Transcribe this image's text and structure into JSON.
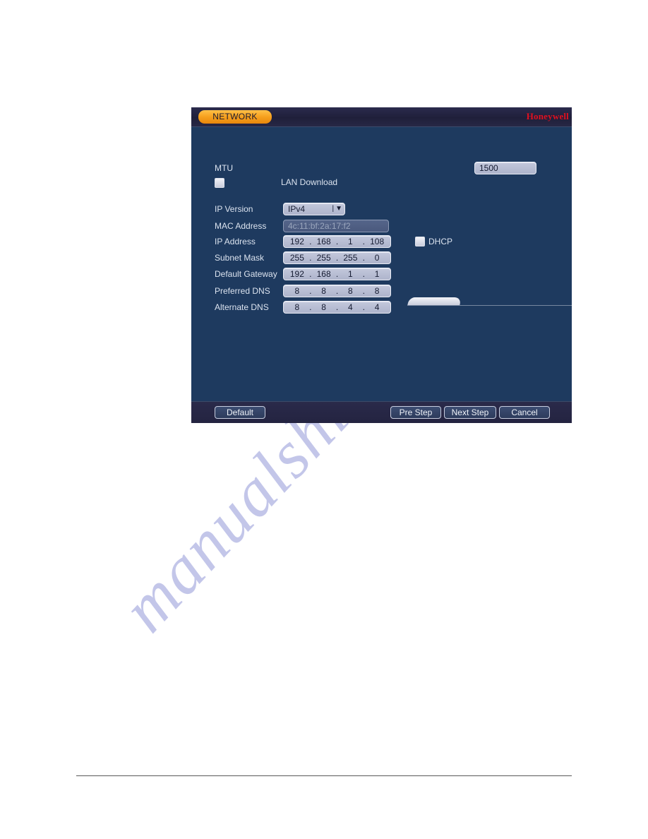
{
  "window": {
    "title": "NETWORK",
    "brand": "Honeywell"
  },
  "form": {
    "mtu": {
      "label": "MTU",
      "value": "1500"
    },
    "lan_download": {
      "label": "LAN Download",
      "checked": false
    },
    "ip_version": {
      "label": "IP Version",
      "value": "IPv4"
    },
    "mac_address": {
      "label": "MAC Address",
      "value": "4c:11:bf:2a:17:f2"
    },
    "ip_address": {
      "label": "IP Address",
      "octets": [
        "192",
        "168",
        "1",
        "108"
      ]
    },
    "subnet_mask": {
      "label": "Subnet Mask",
      "octets": [
        "255",
        "255",
        "255",
        "0"
      ]
    },
    "default_gateway": {
      "label": "Default Gateway",
      "octets": [
        "192",
        "168",
        "1",
        "1"
      ]
    },
    "preferred_dns": {
      "label": "Preferred DNS",
      "octets": [
        "8",
        "8",
        "8",
        "8"
      ]
    },
    "alternate_dns": {
      "label": "Alternate DNS",
      "octets": [
        "8",
        "8",
        "4",
        "4"
      ]
    },
    "dhcp": {
      "label": "DHCP",
      "checked": false
    }
  },
  "footer": {
    "default_label": "Default",
    "pre_step_label": "Pre Step",
    "next_step_label": "Next Step",
    "cancel_label": "Cancel"
  },
  "page": {
    "watermark": "manualshive.com"
  },
  "colors": {
    "panel_bg": "#1e3a5f",
    "title_bar": "#26264a",
    "accent_tab": "#f6a01e",
    "brand_red": "#e01020",
    "field_bg": "#b8bdd4"
  }
}
